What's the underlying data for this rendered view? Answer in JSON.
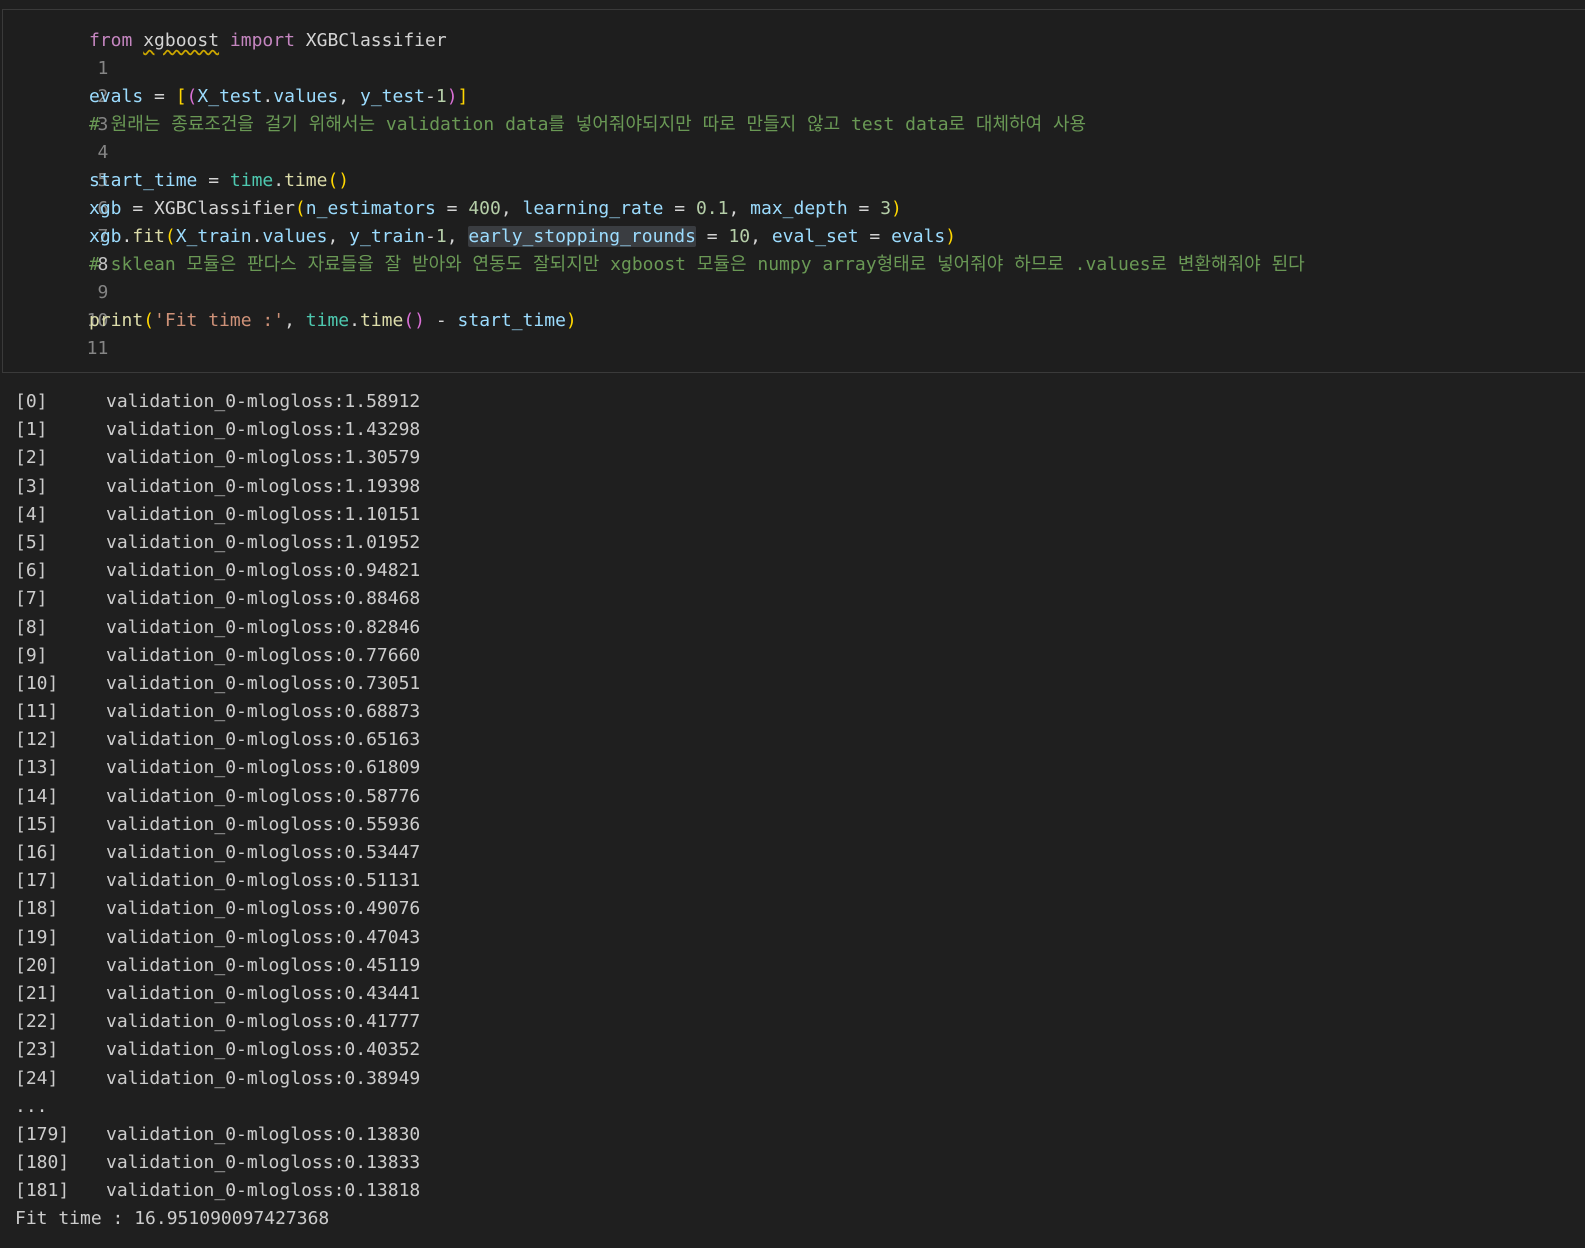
{
  "code_cell": {
    "line_numbers": [
      "1",
      "2",
      "3",
      "4",
      "5",
      "6",
      "7",
      "8",
      "9",
      "10",
      "11"
    ],
    "tokens": {
      "from": "from",
      "xgboost": "xgboost",
      "import": "import",
      "XGBClassifier": "XGBClassifier",
      "evals": "evals",
      "X_test": "X_test",
      "values": "values",
      "y_test": "y_test",
      "one": "1",
      "comment4": "# 원래는 종료조건을 걸기 위해서는 validation data를 넣어줘야되지만 따로 만들지 않고 test data로 대체하여 사용",
      "start_time": "start_time",
      "time": "time",
      "xgb": "xgb",
      "n_estimators": "n_estimators",
      "n400": "400",
      "learning_rate": "learning_rate",
      "n01": "0.1",
      "max_depth": "max_depth",
      "n3": "3",
      "fit": "fit",
      "X_train": "X_train",
      "y_train": "y_train",
      "early_stopping_rounds": "early_stopping_rounds",
      "n10": "10",
      "eval_set": "eval_set",
      "comment9": "# sklean 모듈은 판다스 자료들을 잘 받아와 연동도 잘되지만 xgboost 모듈은 numpy array형태로 넣어줘야 하므로 .values로 변환해줘야 된다",
      "print": "print",
      "fit_str": "'Fit time :'"
    }
  },
  "output": {
    "rows": [
      {
        "idx": "[0]",
        "val": "validation_0-mlogloss:1.58912"
      },
      {
        "idx": "[1]",
        "val": "validation_0-mlogloss:1.43298"
      },
      {
        "idx": "[2]",
        "val": "validation_0-mlogloss:1.30579"
      },
      {
        "idx": "[3]",
        "val": "validation_0-mlogloss:1.19398"
      },
      {
        "idx": "[4]",
        "val": "validation_0-mlogloss:1.10151"
      },
      {
        "idx": "[5]",
        "val": "validation_0-mlogloss:1.01952"
      },
      {
        "idx": "[6]",
        "val": "validation_0-mlogloss:0.94821"
      },
      {
        "idx": "[7]",
        "val": "validation_0-mlogloss:0.88468"
      },
      {
        "idx": "[8]",
        "val": "validation_0-mlogloss:0.82846"
      },
      {
        "idx": "[9]",
        "val": "validation_0-mlogloss:0.77660"
      },
      {
        "idx": "[10]",
        "val": "validation_0-mlogloss:0.73051"
      },
      {
        "idx": "[11]",
        "val": "validation_0-mlogloss:0.68873"
      },
      {
        "idx": "[12]",
        "val": "validation_0-mlogloss:0.65163"
      },
      {
        "idx": "[13]",
        "val": "validation_0-mlogloss:0.61809"
      },
      {
        "idx": "[14]",
        "val": "validation_0-mlogloss:0.58776"
      },
      {
        "idx": "[15]",
        "val": "validation_0-mlogloss:0.55936"
      },
      {
        "idx": "[16]",
        "val": "validation_0-mlogloss:0.53447"
      },
      {
        "idx": "[17]",
        "val": "validation_0-mlogloss:0.51131"
      },
      {
        "idx": "[18]",
        "val": "validation_0-mlogloss:0.49076"
      },
      {
        "idx": "[19]",
        "val": "validation_0-mlogloss:0.47043"
      },
      {
        "idx": "[20]",
        "val": "validation_0-mlogloss:0.45119"
      },
      {
        "idx": "[21]",
        "val": "validation_0-mlogloss:0.43441"
      },
      {
        "idx": "[22]",
        "val": "validation_0-mlogloss:0.41777"
      },
      {
        "idx": "[23]",
        "val": "validation_0-mlogloss:0.40352"
      },
      {
        "idx": "[24]",
        "val": "validation_0-mlogloss:0.38949"
      }
    ],
    "ellipsis": "...",
    "tail_rows": [
      {
        "idx": "[179]",
        "val": "validation_0-mlogloss:0.13830"
      },
      {
        "idx": "[180]",
        "val": "validation_0-mlogloss:0.13833"
      },
      {
        "idx": "[181]",
        "val": "validation_0-mlogloss:0.13818"
      }
    ],
    "fit_time_line": "Fit time : 16.951090097427368"
  }
}
